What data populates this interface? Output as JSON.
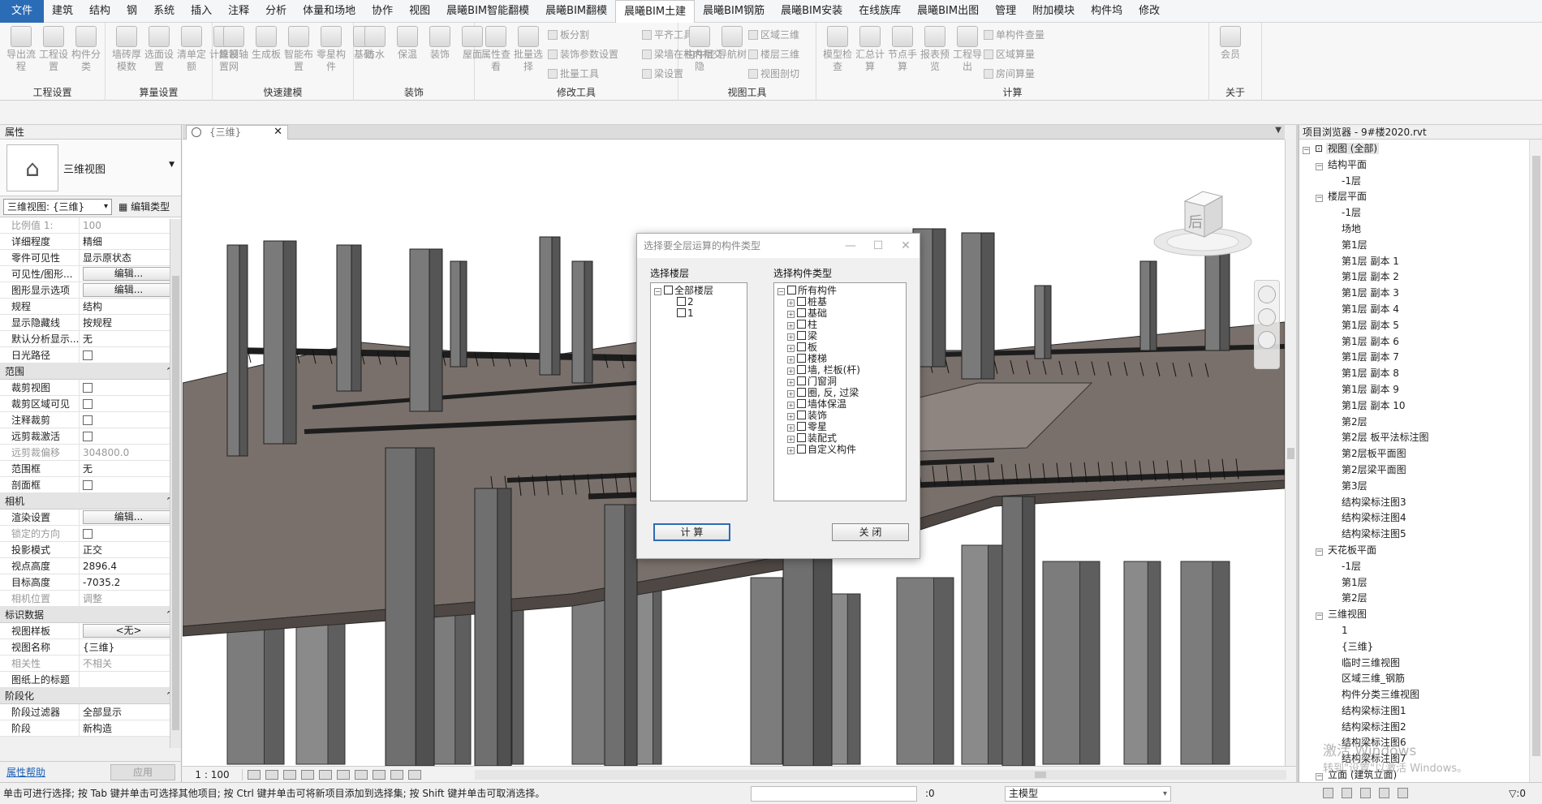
{
  "menu": {
    "items": [
      "文件",
      "建筑",
      "结构",
      "钢",
      "系统",
      "插入",
      "注释",
      "分析",
      "体量和场地",
      "协作",
      "视图",
      "晨曦BIM智能翻模",
      "晨曦BIM翻模",
      "晨曦BIM土建",
      "晨曦BIM钢筋",
      "晨曦BIM安装",
      "在线族库",
      "晨曦BIM出图",
      "管理",
      "附加模块",
      "构件坞",
      "修改"
    ],
    "active": "晨曦BIM土建"
  },
  "ribbon": {
    "groups": [
      {
        "label": "工程设置",
        "buttons": [
          "导出流程",
          "工程设置",
          "构件分类"
        ]
      },
      {
        "label": "算量设置",
        "buttons": [
          "墙砖厚模数",
          "选面设置",
          "清单定额",
          "计算设置"
        ]
      },
      {
        "label": "快速建模",
        "buttons": [
          "绘制轴网",
          "生成板",
          "智能布置",
          "零星构件",
          "基础"
        ]
      },
      {
        "label": "装饰",
        "buttons": [
          "防水",
          "保温",
          "装饰",
          "屋面"
        ]
      },
      {
        "label": "修改工具",
        "buttons": [
          "属性查看",
          "批量选择"
        ],
        "small": [
          "板分割",
          "装饰参数设置",
          "批量工具",
          "平齐工具",
          "梁墙在柱内相交",
          "梁设置"
        ]
      },
      {
        "label": "视图工具",
        "buttons": [
          "构件层隐",
          "导航树"
        ],
        "small": [
          "区域三维",
          "楼层三维",
          "视图剖切"
        ]
      },
      {
        "label": "计算",
        "buttons": [
          "模型检查",
          "汇总计算",
          "节点手算",
          "报表预览",
          "工程导出"
        ],
        "small": [
          "单构件查量",
          "区域算量",
          "房间算量"
        ]
      },
      {
        "label": "关于",
        "buttons": [
          "会员"
        ]
      }
    ]
  },
  "properties": {
    "title": "属性",
    "type_name": "三维视图",
    "view_selector": "三维视图: {三维}",
    "edit_type": "编辑类型",
    "rows": [
      {
        "k": "比例值 1:",
        "v": "100",
        "dim": true
      },
      {
        "k": "详细程度",
        "v": "精细"
      },
      {
        "k": "零件可见性",
        "v": "显示原状态"
      },
      {
        "k": "可见性/图形...",
        "btn": "编辑..."
      },
      {
        "k": "图形显示选项",
        "btn": "编辑..."
      },
      {
        "k": "规程",
        "v": "结构"
      },
      {
        "k": "显示隐藏线",
        "v": "按规程"
      },
      {
        "k": "默认分析显示...",
        "v": "无"
      },
      {
        "k": "日光路径",
        "cb": true
      },
      {
        "cat": "范围"
      },
      {
        "k": "裁剪视图",
        "cb": true
      },
      {
        "k": "裁剪区域可见",
        "cb": true
      },
      {
        "k": "注释裁剪",
        "cb": true
      },
      {
        "k": "远剪裁激活",
        "cb": true
      },
      {
        "k": "远剪裁偏移",
        "v": "304800.0",
        "dim": true
      },
      {
        "k": "范围框",
        "v": "无"
      },
      {
        "k": "剖面框",
        "cb": true
      },
      {
        "cat": "相机"
      },
      {
        "k": "渲染设置",
        "btn": "编辑..."
      },
      {
        "k": "锁定的方向",
        "cb": true,
        "dim": true
      },
      {
        "k": "投影模式",
        "v": "正交"
      },
      {
        "k": "视点高度",
        "v": "2896.4"
      },
      {
        "k": "目标高度",
        "v": "-7035.2"
      },
      {
        "k": "相机位置",
        "v": "调整",
        "dim": true
      },
      {
        "cat": "标识数据"
      },
      {
        "k": "视图样板",
        "btn": "<无>"
      },
      {
        "k": "视图名称",
        "v": "{三维}"
      },
      {
        "k": "相关性",
        "v": "不相关",
        "dim": true
      },
      {
        "k": "图纸上的标题",
        "v": ""
      },
      {
        "cat": "阶段化"
      },
      {
        "k": "阶段过滤器",
        "v": "全部显示"
      },
      {
        "k": "阶段",
        "v": "新构造"
      }
    ],
    "help_link": "属性帮助",
    "apply": "应用"
  },
  "viewport": {
    "tab_label": "{三维}",
    "close": "✕",
    "scale": "1 : 100",
    "viewcube_face": "后"
  },
  "dialog": {
    "title": "选择要全层运算的构件类型",
    "floor_label": "选择楼层",
    "type_label": "选择构件类型",
    "floors_root": "全部楼层",
    "floors": [
      "2",
      "1"
    ],
    "types_root": "所有构件",
    "types": [
      "桩基",
      "基础",
      "柱",
      "梁",
      "板",
      "楼梯",
      "墙, 栏板(杆)",
      "门窗洞",
      "圈, 反, 过梁",
      "墙体保温",
      "装饰",
      "零星",
      "装配式",
      "自定义构件"
    ],
    "calc": "计  算",
    "close": "关  闭"
  },
  "project_browser": {
    "title": "项目浏览器 - 9#楼2020.rvt",
    "tree": [
      {
        "level": 0,
        "text": "视图 (全部)",
        "ex": "-",
        "sel": true
      },
      {
        "level": 1,
        "text": "结构平面",
        "ex": "-"
      },
      {
        "level": 2,
        "text": "-1层"
      },
      {
        "level": 1,
        "text": "楼层平面",
        "ex": "-"
      },
      {
        "level": 2,
        "text": "-1层"
      },
      {
        "level": 2,
        "text": "场地"
      },
      {
        "level": 2,
        "text": "第1层"
      },
      {
        "level": 2,
        "text": "第1层 副本 1"
      },
      {
        "level": 2,
        "text": "第1层 副本 2"
      },
      {
        "level": 2,
        "text": "第1层 副本 3"
      },
      {
        "level": 2,
        "text": "第1层 副本 4"
      },
      {
        "level": 2,
        "text": "第1层 副本 5"
      },
      {
        "level": 2,
        "text": "第1层 副本 6"
      },
      {
        "level": 2,
        "text": "第1层 副本 7"
      },
      {
        "level": 2,
        "text": "第1层 副本 8"
      },
      {
        "level": 2,
        "text": "第1层 副本 9"
      },
      {
        "level": 2,
        "text": "第1层 副本 10"
      },
      {
        "level": 2,
        "text": "第2层"
      },
      {
        "level": 2,
        "text": "第2层 板平法标注图"
      },
      {
        "level": 2,
        "text": "第2层板平面图"
      },
      {
        "level": 2,
        "text": "第2层梁平面图"
      },
      {
        "level": 2,
        "text": "第3层"
      },
      {
        "level": 2,
        "text": "结构梁标注图3"
      },
      {
        "level": 2,
        "text": "结构梁标注图4"
      },
      {
        "level": 2,
        "text": "结构梁标注图5"
      },
      {
        "level": 1,
        "text": "天花板平面",
        "ex": "-"
      },
      {
        "level": 2,
        "text": "-1层"
      },
      {
        "level": 2,
        "text": "第1层"
      },
      {
        "level": 2,
        "text": "第2层"
      },
      {
        "level": 1,
        "text": "三维视图",
        "ex": "-"
      },
      {
        "level": 2,
        "text": "1"
      },
      {
        "level": 2,
        "text": "{三维}"
      },
      {
        "level": 2,
        "text": "临时三维视图"
      },
      {
        "level": 2,
        "text": "区域三维_钢筋"
      },
      {
        "level": 2,
        "text": "构件分类三维视图"
      },
      {
        "level": 2,
        "text": "结构梁标注图1"
      },
      {
        "level": 2,
        "text": "结构梁标注图2"
      },
      {
        "level": 2,
        "text": "结构梁标注图6"
      },
      {
        "level": 2,
        "text": "结构梁标注图7"
      },
      {
        "level": 1,
        "text": "立面 (建筑立面)",
        "ex": "-"
      }
    ],
    "watermark_1": "激活 Windows",
    "watermark_2": "转到\"设置\"以激活 Windows。"
  },
  "status": {
    "message": "单击可进行选择; 按 Tab 键并单击可选择其他项目; 按 Ctrl 键并单击可将新项目添加到选择集; 按 Shift 键并单击可取消选择。",
    "zero": ":0",
    "model": "主模型",
    "filter_zero": ":0"
  },
  "colors": {
    "file_menu": "#2b6cb6",
    "concrete": "#6f6f6f",
    "slab": "#7a706b"
  }
}
